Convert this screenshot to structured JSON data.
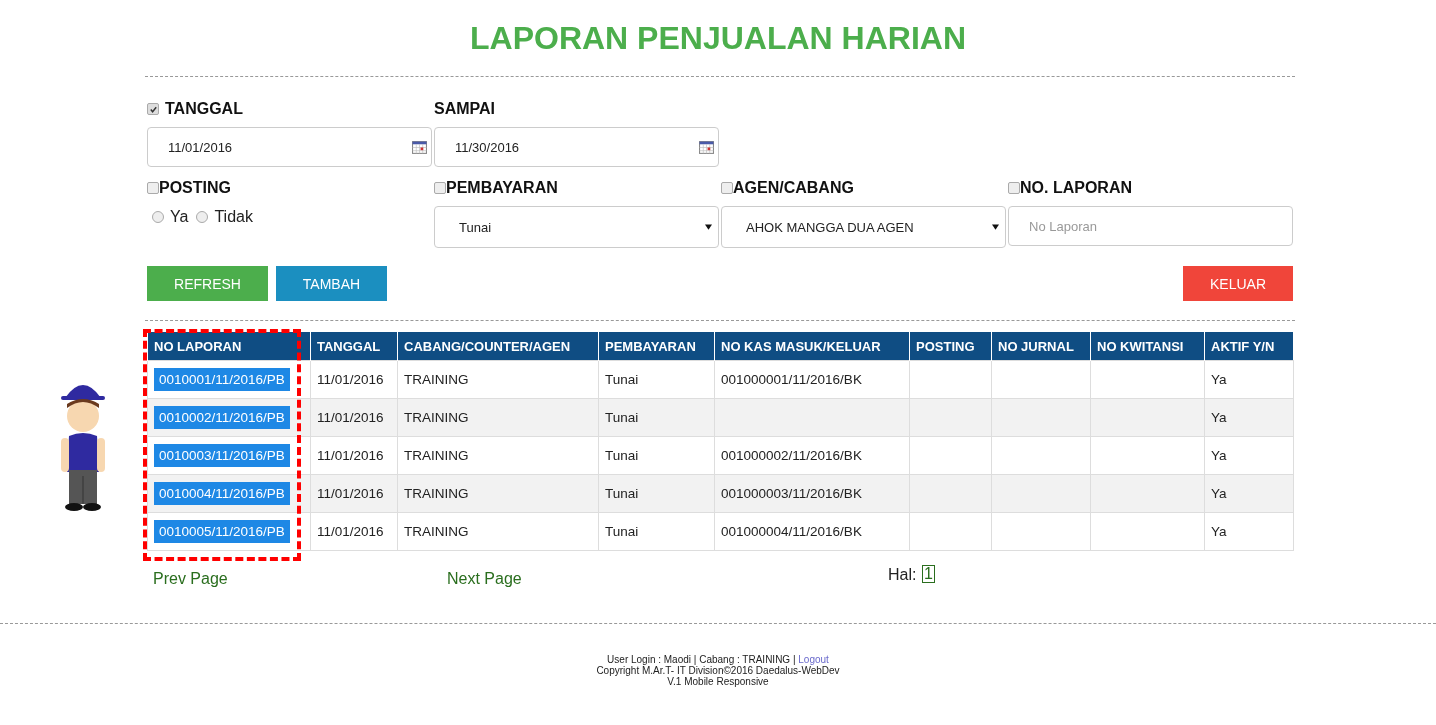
{
  "title": "LAPORAN PENJUALAN HARIAN",
  "date_from": {
    "label": "TANGGAL",
    "checked": true,
    "value": "11/01/2016"
  },
  "date_to": {
    "label": "SAMPAI",
    "value": "11/30/2016"
  },
  "filters": [
    {
      "label": "POSTING",
      "checked": false,
      "kind": "radios",
      "options": [
        {
          "label": "Ya",
          "selected": false
        },
        {
          "label": "Tidak",
          "selected": false
        }
      ]
    },
    {
      "label": "PEMBAYARAN",
      "checked": false,
      "kind": "select",
      "value": "Tunai"
    },
    {
      "label": "AGEN/CABANG",
      "checked": false,
      "kind": "select",
      "value": "AHOK MANGGA DUA AGEN"
    },
    {
      "label": "NO. LAPORAN",
      "checked": false,
      "kind": "input",
      "placeholder": "No Laporan"
    }
  ],
  "buttons": [
    {
      "label": "REFRESH",
      "kind": "success"
    },
    {
      "label": "TAMBAH",
      "kind": "info"
    },
    {
      "label": "KELUAR",
      "kind": "danger"
    }
  ],
  "table": {
    "columns": [
      "NO LAPORAN",
      "TANGGAL",
      "CABANG/COUNTER/AGEN",
      "PEMBAYARAN",
      "NO KAS MASUK/KELUAR",
      "POSTING",
      "NO JURNAL",
      "NO KWITANSI",
      "AKTIF Y/N"
    ],
    "rows": [
      [
        "0010001/11/2016/PB",
        "11/01/2016",
        "TRAINING",
        "Tunai",
        "001000001/11/2016/BK",
        "",
        "",
        "",
        "Ya"
      ],
      [
        "0010002/11/2016/PB",
        "11/01/2016",
        "TRAINING",
        "Tunai",
        "",
        "",
        "",
        "",
        "Ya"
      ],
      [
        "0010003/11/2016/PB",
        "11/01/2016",
        "TRAINING",
        "Tunai",
        "001000002/11/2016/BK",
        "",
        "",
        "",
        "Ya"
      ],
      [
        "0010004/11/2016/PB",
        "11/01/2016",
        "TRAINING",
        "Tunai",
        "001000003/11/2016/BK",
        "",
        "",
        "",
        "Ya"
      ],
      [
        "0010005/11/2016/PB",
        "11/01/2016",
        "TRAINING",
        "Tunai",
        "001000004/11/2016/BK",
        "",
        "",
        "",
        "Ya"
      ]
    ]
  },
  "pagination": {
    "prev": "Prev Page",
    "next": "Next Page",
    "label": "Hal:",
    "pages": [
      {
        "label": "1",
        "selected": true
      }
    ]
  },
  "footer": {
    "user_line": "User Login : Maodi | Cabang : TRAINING |",
    "logout": "Logout",
    "copyright": "Copyright M.Ar.T- IT Division©2016 Daedalus-WebDev",
    "version": "V.1 Mobile Responsive"
  }
}
